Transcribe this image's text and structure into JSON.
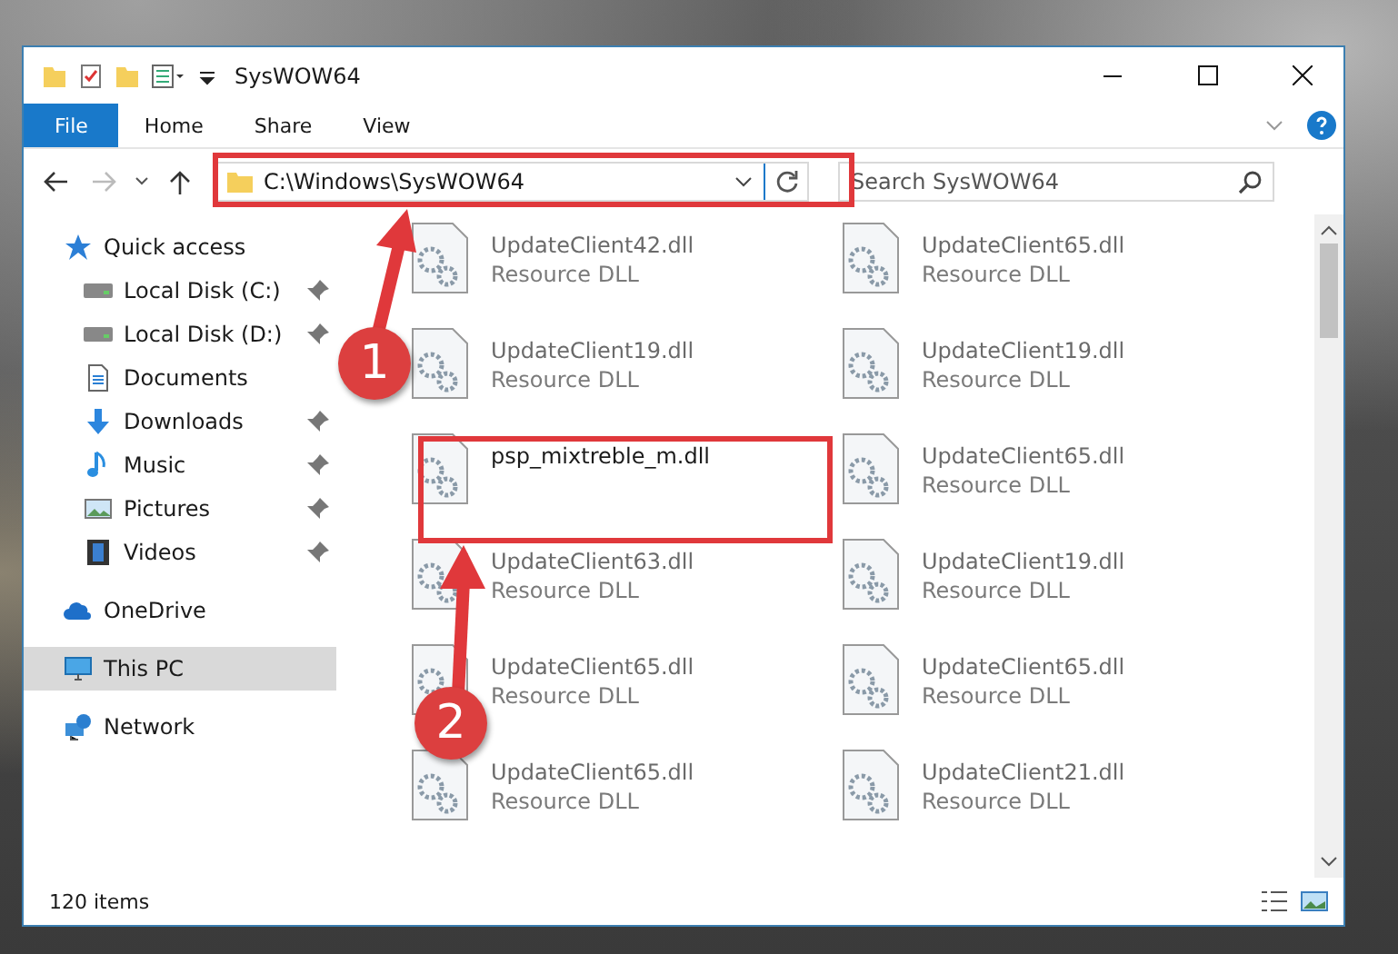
{
  "window": {
    "title": "SysWOW64"
  },
  "ribbon": {
    "tabs": [
      {
        "label": "File",
        "kind": "file"
      },
      {
        "label": "Home",
        "kind": "tab"
      },
      {
        "label": "Share",
        "kind": "tab"
      },
      {
        "label": "View",
        "kind": "tab"
      }
    ]
  },
  "address": {
    "path": "C:\\Windows\\SysWOW64"
  },
  "search": {
    "placeholder": "Search SysWOW64"
  },
  "sidebar": {
    "items": [
      {
        "label": "Quick access",
        "kind": "star",
        "selected": false,
        "children": [
          {
            "label": "Local Disk (C:)",
            "kind": "disk",
            "pinned": true
          },
          {
            "label": "Local Disk (D:)",
            "kind": "disk",
            "pinned": true
          },
          {
            "label": "Documents",
            "kind": "document",
            "pinned": false
          },
          {
            "label": "Downloads",
            "kind": "download",
            "pinned": true
          },
          {
            "label": "Music",
            "kind": "music",
            "pinned": true
          },
          {
            "label": "Pictures",
            "kind": "pictures",
            "pinned": true
          },
          {
            "label": "Videos",
            "kind": "videos",
            "pinned": true
          }
        ]
      },
      {
        "label": "OneDrive",
        "kind": "cloud",
        "selected": false
      },
      {
        "label": "This PC",
        "kind": "pc",
        "selected": true
      },
      {
        "label": "Network",
        "kind": "network",
        "selected": false
      }
    ]
  },
  "files": [
    {
      "name": "UpdateClient42.dll",
      "type": "Resource DLL",
      "dimmed": true
    },
    {
      "name": "UpdateClient65.dll",
      "type": "Resource DLL",
      "dimmed": true
    },
    {
      "name": "UpdateClient19.dll",
      "type": "Resource DLL",
      "dimmed": true
    },
    {
      "name": "UpdateClient19.dll",
      "type": "Resource DLL",
      "dimmed": true
    },
    {
      "name": "psp_mixtreble_m.dll",
      "dimmed": false
    },
    {
      "name": "UpdateClient65.dll",
      "type": "Resource DLL",
      "dimmed": true
    },
    {
      "name": "UpdateClient63.dll",
      "type": "Resource DLL",
      "dimmed": true
    },
    {
      "name": "UpdateClient19.dll",
      "type": "Resource DLL",
      "dimmed": true
    },
    {
      "name": "UpdateClient65.dll",
      "type": "Resource DLL",
      "dimmed": true
    },
    {
      "name": "UpdateClient65.dll",
      "type": "Resource DLL",
      "dimmed": true
    },
    {
      "name": "UpdateClient65.dll",
      "type": "Resource DLL",
      "dimmed": true
    },
    {
      "name": "UpdateClient21.dll",
      "type": "Resource DLL",
      "dimmed": true
    }
  ],
  "status_bar": {
    "item_count": "120 items"
  },
  "annotations": [
    {
      "label": "1"
    },
    {
      "label": "2"
    }
  ]
}
